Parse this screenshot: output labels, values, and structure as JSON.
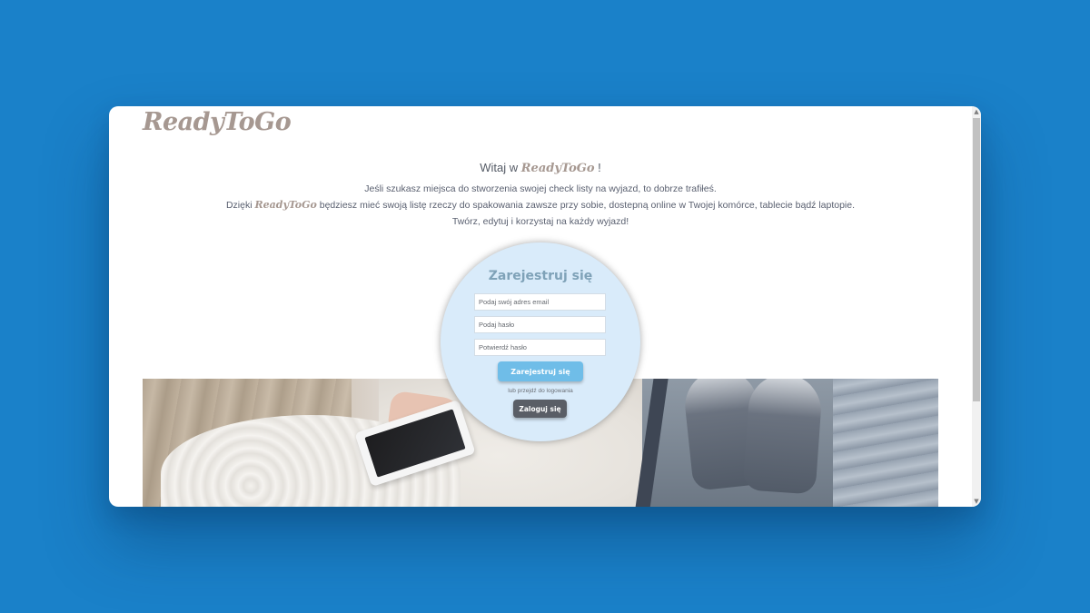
{
  "brand": {
    "name": "ReadyToGo"
  },
  "welcome": {
    "prefix": "Witaj w",
    "brand": "ReadyToGo",
    "suffix": " !"
  },
  "intro": {
    "line1": "Jeśli szukasz miejsca do stworzenia swojej check listy na wyjazd, to dobrze trafiłeś.",
    "line2_prefix": "Dzięki",
    "line2_brand": "ReadyToGo",
    "line2_suffix": " będziesz mieć swoją listę rzeczy do spakowania zawsze przy sobie, dostepną online w Twojej komórce, tablecie bądź laptopie.",
    "line3": "Twórz, edytuj i korzystaj na każdy wyjazd!"
  },
  "register": {
    "title": "Zarejestruj się",
    "email_placeholder": "Podaj swój adres email",
    "password_placeholder": "Podaj hasło",
    "confirm_placeholder": "Potwierdź hasło",
    "submit_label": "Zarejestruj się",
    "or_login_text": "lub przejdź do logowania",
    "login_label": "Zaloguj się"
  },
  "colors": {
    "background": "#1a81c9",
    "brand": "#a69891",
    "circle": "#d9ebfa",
    "register_button": "#6fbde8",
    "login_button": "#5a5e66"
  },
  "icons": {
    "scroll_up": "scroll-up-arrow-icon",
    "scroll_down": "scroll-down-arrow-icon"
  }
}
